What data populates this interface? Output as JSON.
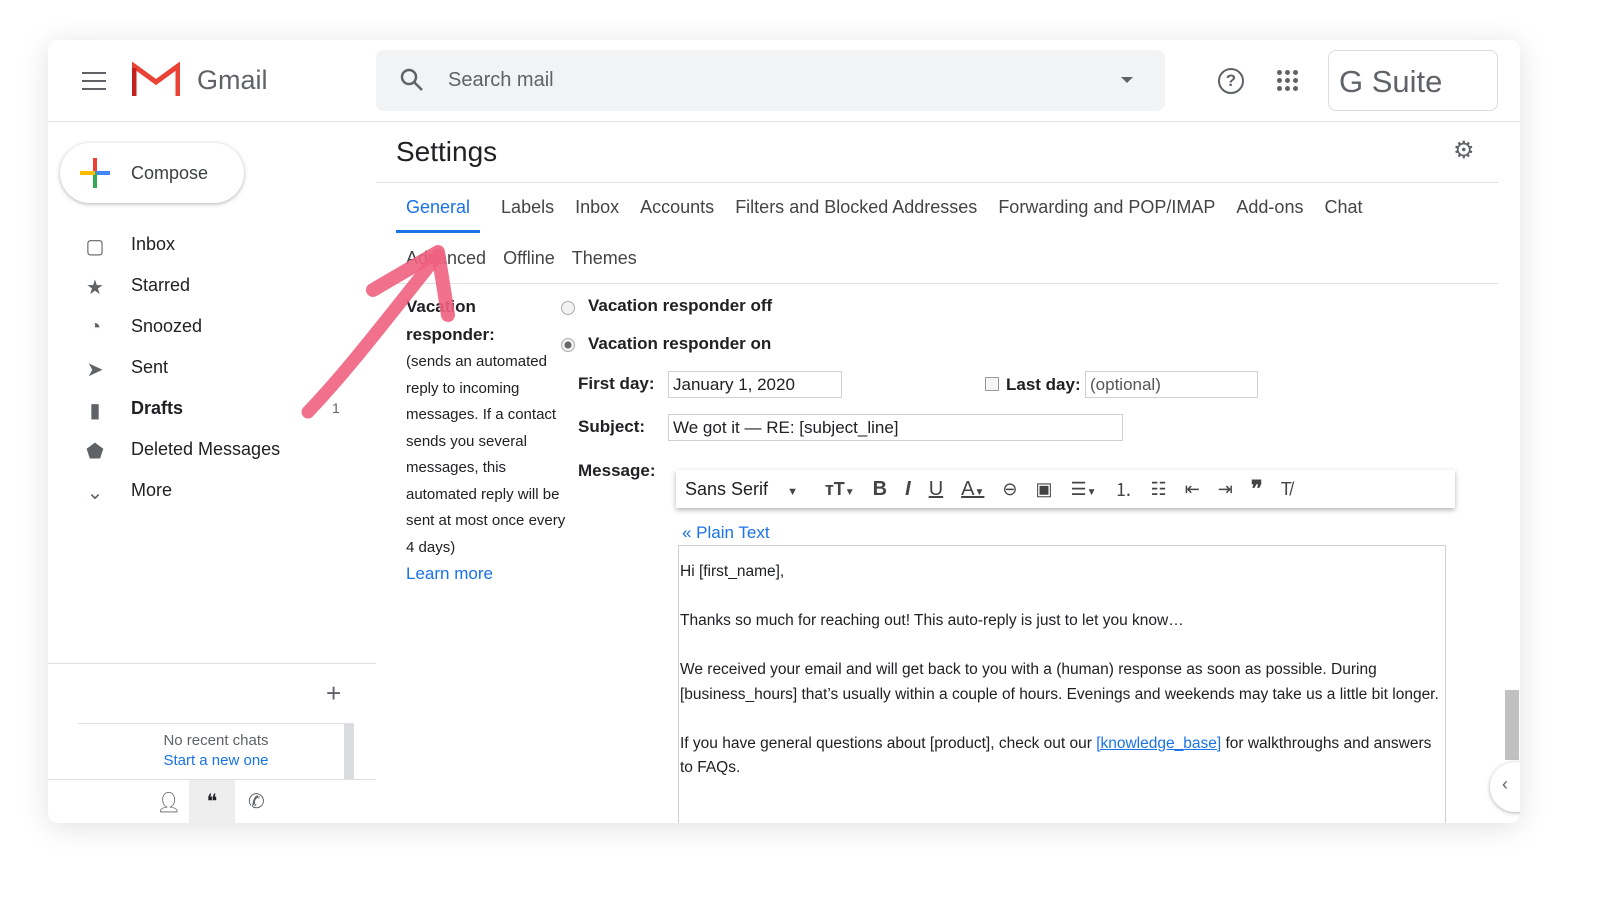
{
  "header": {
    "brand": "Gmail",
    "search_placeholder": "Search mail",
    "suite": "G Suite"
  },
  "sidebar": {
    "compose": "Compose",
    "items": [
      {
        "label": "Inbox",
        "icon": "inbox-icon",
        "glyph": "▢"
      },
      {
        "label": "Starred",
        "icon": "star-icon",
        "glyph": "★"
      },
      {
        "label": "Snoozed",
        "icon": "clock-icon",
        "glyph": "◔"
      },
      {
        "label": "Sent",
        "icon": "send-icon",
        "glyph": "➤"
      },
      {
        "label": "Drafts",
        "icon": "draft-icon",
        "glyph": "▮",
        "count": "1",
        "bold": true
      },
      {
        "label": "Deleted Messages",
        "icon": "label-icon",
        "glyph": "⬟"
      },
      {
        "label": "More",
        "icon": "chevron-down-icon",
        "glyph": "⌄"
      }
    ],
    "chat": {
      "no_recent": "No recent chats",
      "start": "Start a new one"
    }
  },
  "settings": {
    "title": "Settings",
    "tabs": [
      "General",
      "Labels",
      "Inbox",
      "Accounts",
      "Filters and Blocked Addresses",
      "Forwarding and POP/IMAP",
      "Add-ons",
      "Chat"
    ],
    "tabs_row2": [
      "Advanced",
      "Offline",
      "Themes"
    ],
    "vacation": {
      "label": "Vacation responder:",
      "desc": "(sends an automated reply to incoming messages. If a contact sends you several messages, this automated reply will be sent at most once every 4 days)",
      "learn_more": "Learn more",
      "off": "Vacation responder off",
      "on": "Vacation responder on",
      "first_day_label": "First day:",
      "first_day": "January 1, 2020",
      "last_day_label": "Last day:",
      "last_day_placeholder": "(optional)",
      "subject_label": "Subject:",
      "subject": "We got it — RE: [subject_line]",
      "message_label": "Message:",
      "font": "Sans Serif",
      "plain_text": "« Plain Text",
      "body": {
        "p1": "Hi [first_name],",
        "p2": "Thanks so much for reaching out! This auto-reply is just to let you know…",
        "p3": "We received your email and will get back to you with a (human) response as soon as possible. During [business_hours] that’s usually within a couple of hours. Evenings and weekends may take us a little bit longer.",
        "p4a": "If you have general questions about [product], check out our ",
        "p4link": "[knowledge_base]",
        "p4b": " for walkthroughs and answers to FAQs."
      }
    }
  },
  "colors": {
    "accent": "#1a73e8",
    "arrow": "#f06080"
  }
}
